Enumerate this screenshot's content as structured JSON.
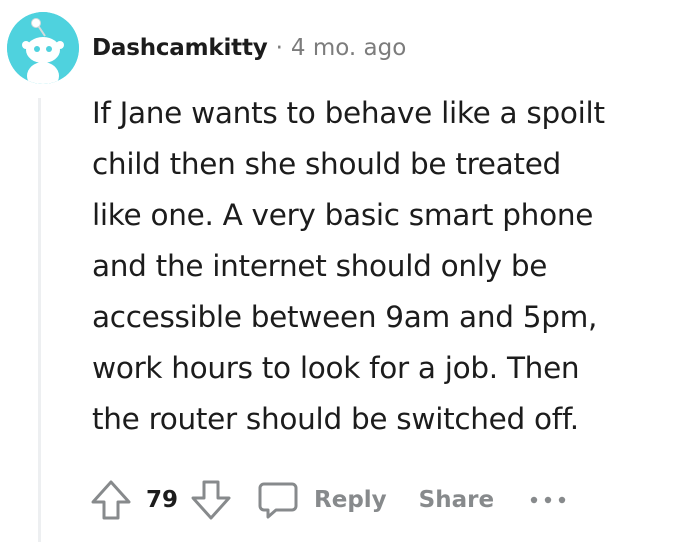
{
  "comment": {
    "author": "Dashcamkitty",
    "separator": "·",
    "timestamp": "4 mo. ago",
    "body_lines": [
      "If Jane wants to behave like a spoilt",
      "child then she should be treated",
      "like one. A very basic smart phone",
      "and the internet should only be",
      "accessible between 9am and 5pm,",
      "work hours to look for a job. Then",
      "the router should be switched off."
    ]
  },
  "actions": {
    "vote_count": "79",
    "reply_label": "Reply",
    "share_label": "Share",
    "upvote_icon": "upvote-arrow-icon",
    "downvote_icon": "downvote-arrow-icon",
    "reply_icon": "comment-bubble-icon",
    "more_icon": "more-options-icon"
  },
  "colors": {
    "avatar_bg": "#4fd2de",
    "text": "#1c1c1c",
    "muted": "#878a8c",
    "thread_line": "#edeff1"
  }
}
